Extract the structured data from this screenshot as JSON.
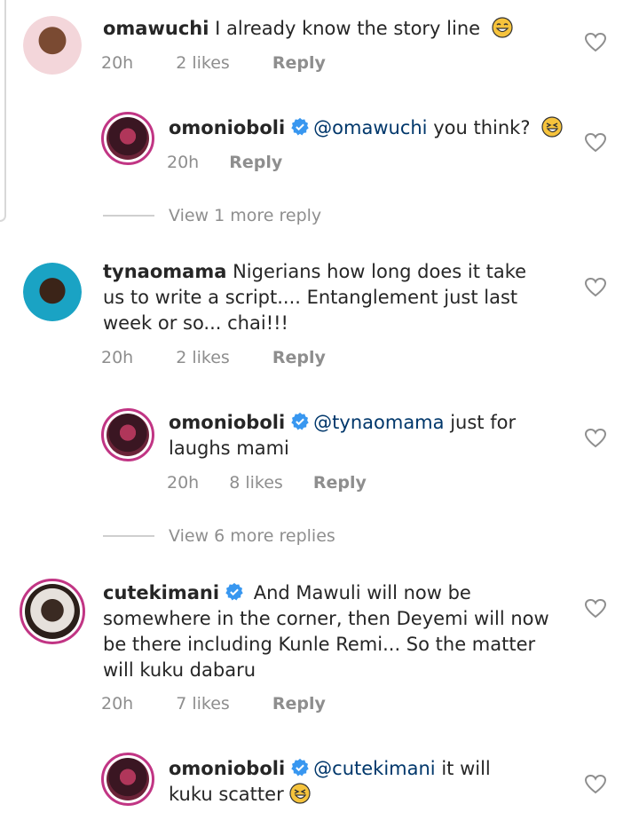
{
  "comments": [
    {
      "user": "omawuchi",
      "text": "I already know the story line",
      "time": "20h",
      "likes": "2 likes",
      "reply": "Reply"
    },
    {
      "user": "omonioboli",
      "mention": "@omawuchi",
      "text": "you think?",
      "time": "20h",
      "reply": "Reply"
    },
    {
      "user": "tynaomama",
      "text": "Nigerians how long does it take",
      "text2": "us to write a script.... Entanglement just last",
      "text3": "week or so... chai!!!",
      "time": "20h",
      "likes": "2 likes",
      "reply": "Reply"
    },
    {
      "user": "omonioboli",
      "mention": "@tynaomama",
      "text": "just for",
      "text2": "laughs mami",
      "time": "20h",
      "likes": "8 likes",
      "reply": "Reply"
    },
    {
      "user": "cutekimani",
      "text": "And Mawuli will now be",
      "text2": "somewhere in the corner, then Deyemi will now",
      "text3": "be there including Kunle Remi... So the matter",
      "text4": "will kuku dabaru",
      "time": "20h",
      "likes": "7 likes",
      "reply": "Reply"
    },
    {
      "user": "omonioboli",
      "mention": "@cutekimani",
      "text": "it will",
      "text2": "kuku scatter"
    }
  ],
  "view_more_1": "View 1 more reply",
  "view_more_2": "View 6 more replies",
  "colors": {
    "text": "#262626",
    "meta": "#8e8e8e",
    "mention": "#00376b",
    "verified": "#3897f0",
    "story_ring": "#c13584"
  }
}
